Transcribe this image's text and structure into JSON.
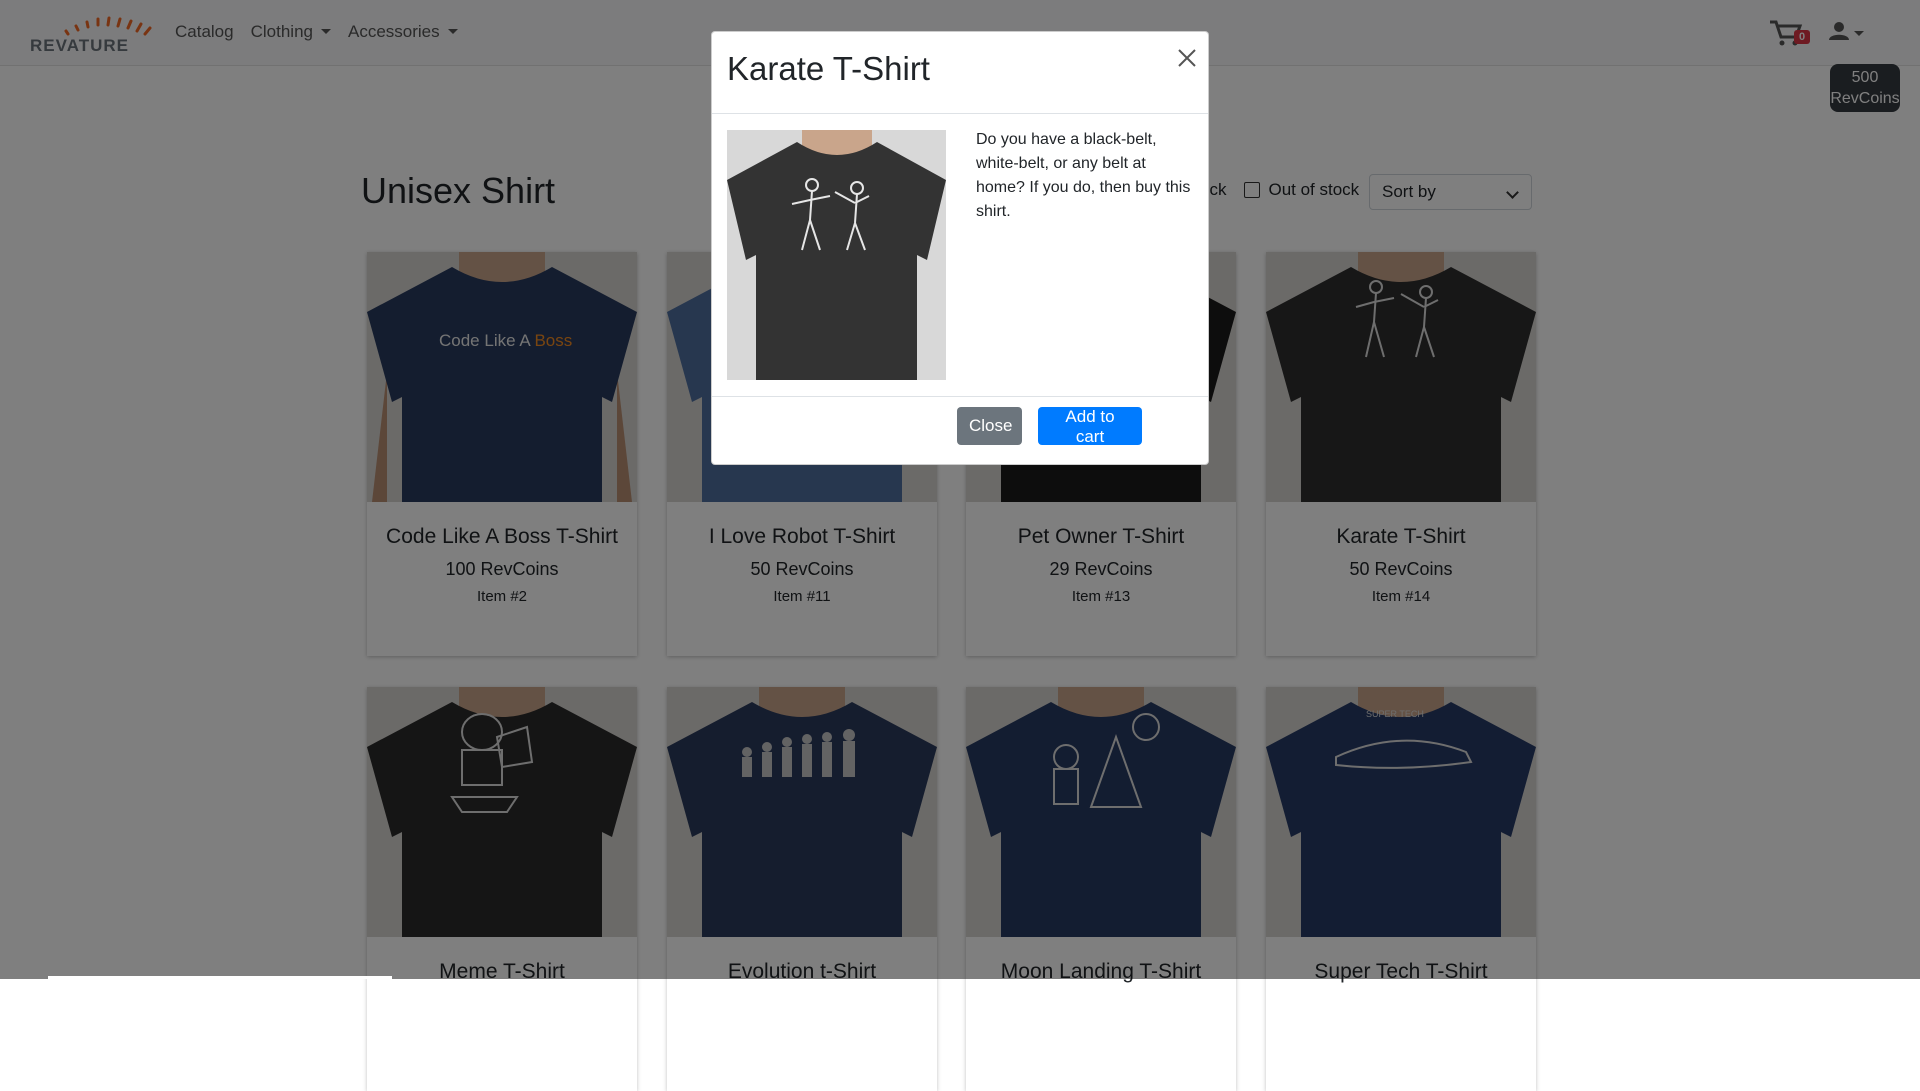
{
  "brand": {
    "name": "REVATURE",
    "accent": "#f26925"
  },
  "nav": {
    "catalog": "Catalog",
    "clothing": "Clothing",
    "accessories": "Accessories"
  },
  "header_right": {
    "cart_icon": "cart-icon",
    "cart_count": "0",
    "user_icon": "user-icon",
    "coins_amount": "500",
    "coins_unit": "RevCoins"
  },
  "page": {
    "title": "Unisex Shirt",
    "filter_instock_partial": "ock",
    "filter_outofstock": "Out of stock",
    "sort_label": "Sort by"
  },
  "products": [
    {
      "name": "Code Like A Boss T-Shirt",
      "price": "100 RevCoins",
      "item": "Item #2",
      "shirt_color": "#283a5e",
      "print_text_a": "Code Like A ",
      "print_text_b": "Boss"
    },
    {
      "name": "I Love Robot T-Shirt",
      "price": "50 RevCoins",
      "item": "Item #11",
      "shirt_color": "#4f6f9f"
    },
    {
      "name": "Pet Owner T-Shirt",
      "price": "29 RevCoins",
      "item": "Item #13",
      "shirt_color": "#1b1b1b"
    },
    {
      "name": "Karate T-Shirt",
      "price": "50 RevCoins",
      "item": "Item #14",
      "shirt_color": "#2e2e2e"
    },
    {
      "name": "Meme T-Shirt",
      "shirt_color": "#2a2a2a"
    },
    {
      "name": "Evolution t-Shirt",
      "shirt_color": "#2b3a5c"
    },
    {
      "name": "Moon Landing T-Shirt",
      "shirt_color": "#273a62"
    },
    {
      "name": "Super Tech T-Shirt",
      "shirt_color": "#263a66",
      "print_text": "SUPER TECH"
    }
  ],
  "modal": {
    "title": "Karate T-Shirt",
    "description": "Do you have a black-belt, white-belt, or any belt at home? If you do, then buy this shirt.",
    "close_label": "Close",
    "add_label": "Add to cart",
    "shirt_color": "#333333"
  }
}
